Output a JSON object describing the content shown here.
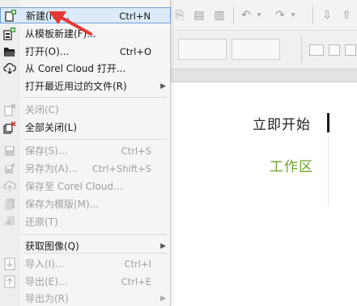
{
  "menu": {
    "items": [
      {
        "label": "新建(N)...",
        "shortcut": "Ctrl+N",
        "enabled": true,
        "icon": "new-document-icon"
      },
      {
        "label": "从模板新建(F)...",
        "shortcut": "",
        "enabled": true,
        "icon": "new-from-template-icon"
      },
      {
        "label": "打开(O)...",
        "shortcut": "Ctrl+O",
        "enabled": true,
        "icon": "folder-open-icon"
      },
      {
        "label": "从 Corel Cloud 打开...",
        "shortcut": "",
        "enabled": true,
        "icon": "cloud-download-icon"
      },
      {
        "label": "打开最近用过的文件(R)",
        "shortcut": "",
        "enabled": true,
        "submenu": true
      },
      {
        "label": "关闭(C)",
        "shortcut": "",
        "enabled": false,
        "icon": "close-document-icon"
      },
      {
        "label": "全部关闭(L)",
        "shortcut": "",
        "enabled": true,
        "icon": "close-all-icon"
      },
      {
        "label": "保存(S)...",
        "shortcut": "Ctrl+S",
        "enabled": false,
        "icon": "save-icon"
      },
      {
        "label": "另存为(A)...",
        "shortcut": "Ctrl+Shift+S",
        "enabled": false,
        "icon": "save-as-icon"
      },
      {
        "label": "保存至 Corel Cloud...",
        "shortcut": "",
        "enabled": false,
        "icon": "cloud-upload-icon"
      },
      {
        "label": "保存为模版(M)...",
        "shortcut": "",
        "enabled": false,
        "icon": "save-template-icon"
      },
      {
        "label": "还原(T)",
        "shortcut": "",
        "enabled": false,
        "icon": "revert-icon"
      },
      {
        "label": "获取图像(Q)",
        "shortcut": "",
        "enabled": true,
        "submenu": true
      },
      {
        "label": "导入(I)...",
        "shortcut": "Ctrl+I",
        "enabled": false,
        "icon": "import-icon"
      },
      {
        "label": "导出(E)...",
        "shortcut": "Ctrl+E",
        "enabled": false,
        "icon": "export-icon"
      },
      {
        "label": "导出为(R)",
        "shortcut": "",
        "enabled": false,
        "submenu": true
      }
    ]
  },
  "welcome": {
    "start": "立即开始",
    "workspace": "工作区"
  },
  "colors": {
    "highlight": "#dbe9f8",
    "accent_green": "#6aa329",
    "annotation_red": "#e53935"
  }
}
